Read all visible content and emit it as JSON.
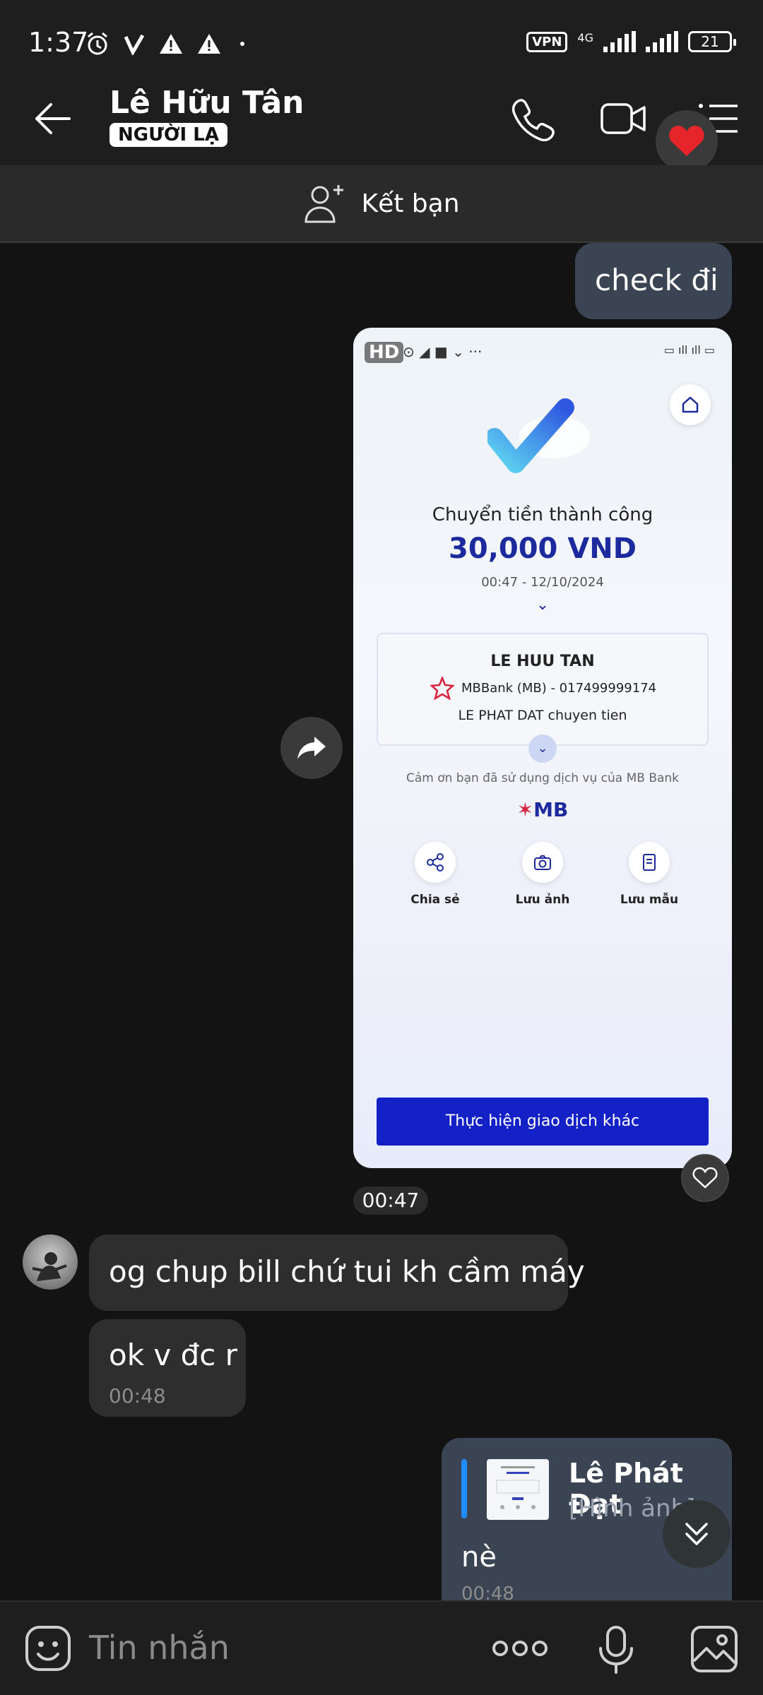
{
  "status_bar": {
    "time": "1:37",
    "vpn": "VPN",
    "network": "4G",
    "battery": "21"
  },
  "header": {
    "contact_name": "Lê Hữu Tân",
    "badge": "NGƯỜI LẠ"
  },
  "add_friend": {
    "label": "Kết bạn"
  },
  "messages": {
    "out1": {
      "text": "check đi"
    },
    "image": {
      "hd_label": "HD",
      "receipt": {
        "title": "Chuyển tiền thành công",
        "amount": "30,000 VND",
        "datetime": "00:47 - 12/10/2024",
        "recipient_name": "LE HUU TAN",
        "recipient_bank": "MBBank (MB) - 017499999174",
        "note": "LE PHAT DAT chuyen tien",
        "thanks": "Cảm ơn bạn đã sử dụng dịch vụ của MB Bank",
        "bank_logo": "MB",
        "actions": [
          "Chia sẻ",
          "Lưu ảnh",
          "Lưu mẫu"
        ],
        "other_transaction": "Thực hiện giao dịch khác"
      }
    },
    "image_time": "00:47",
    "in1": {
      "text": "og chup bill chứ tui kh cầm máy"
    },
    "in2": {
      "text": "ok v đc r",
      "time": "00:48"
    },
    "reply": {
      "quoted_name": "Lê Phát Đạt",
      "quoted_type": "[Hình ảnh]",
      "text": "nè",
      "time": "00:48"
    }
  },
  "input": {
    "placeholder": "Tin nhắn"
  },
  "icons": {
    "back": "arrow-left-icon",
    "call": "phone-icon",
    "video": "video-camera-icon",
    "menu": "list-menu-icon",
    "reaction": "heart-icon",
    "add_friend": "add-user-icon",
    "share": "share-forward-icon",
    "like": "heart-outline-icon",
    "scroll": "double-chevron-down-icon",
    "sticker": "emoji-icon",
    "more": "more-dots-icon",
    "mic": "microphone-icon",
    "gallery": "image-icon"
  },
  "colors": {
    "background": "#131313",
    "outgoing_bubble": "#3b4452",
    "incoming_bubble": "#2e2e2e",
    "mb_blue": "#1d2a9e",
    "mb_button": "#1421c7"
  }
}
